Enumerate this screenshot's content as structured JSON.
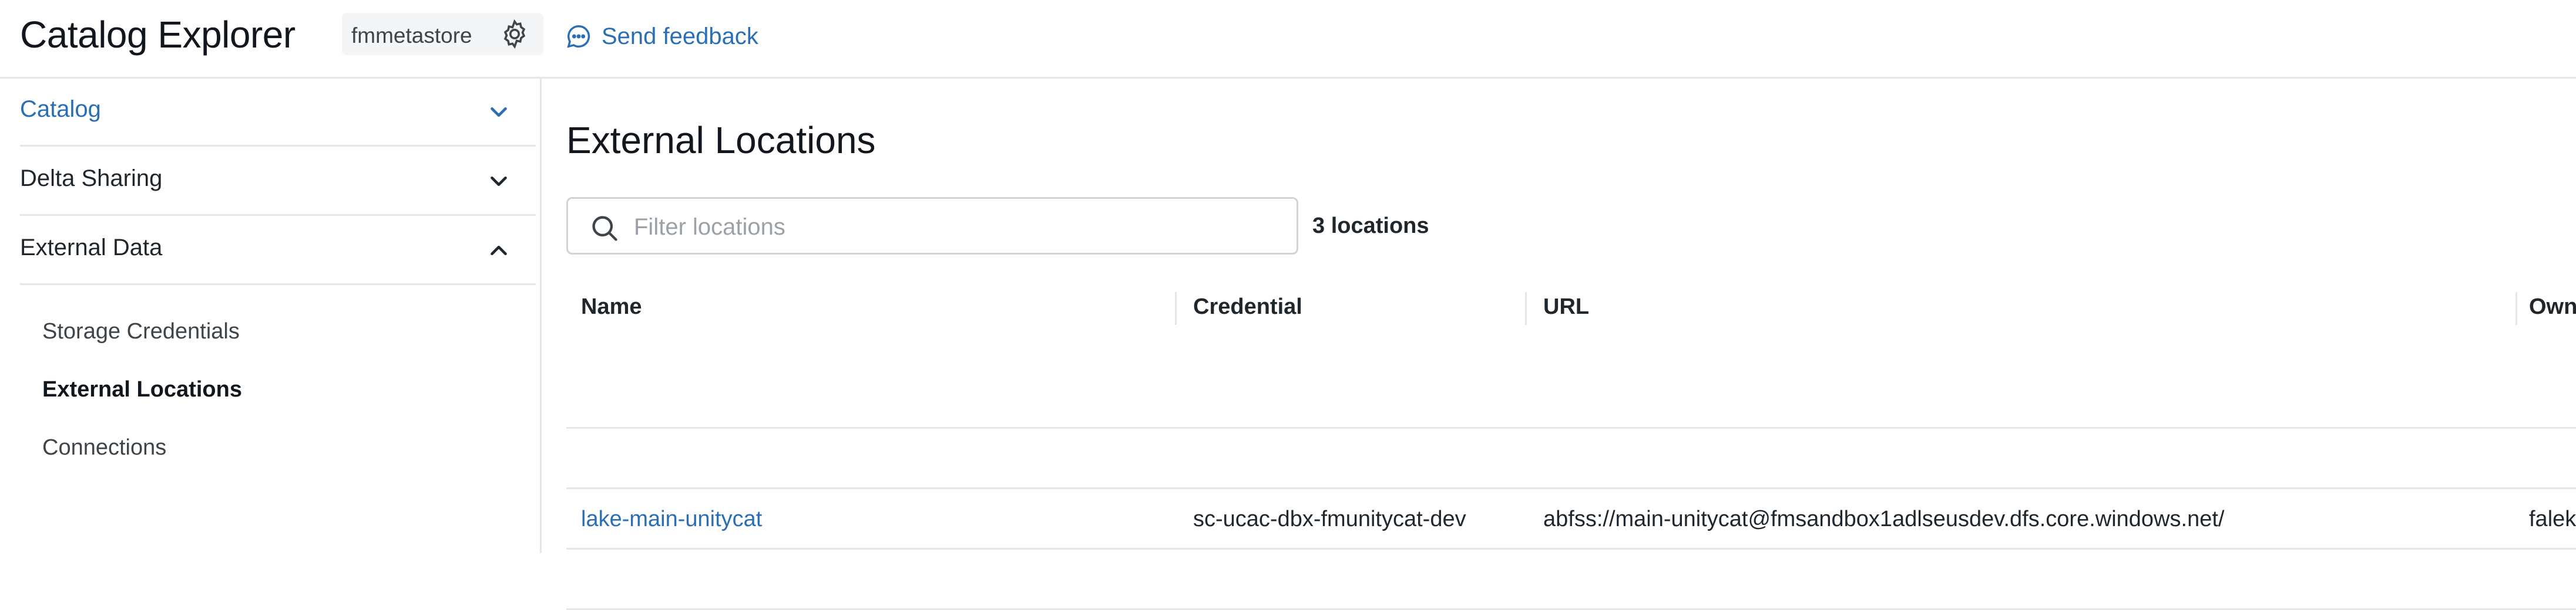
{
  "header": {
    "app_title": "Catalog Explorer",
    "metastore": "fmmetastore",
    "settings_icon": "gear-icon",
    "feedback_label": "Send feedback",
    "feedback_icon": "chat-bubble-icon"
  },
  "sidebar": {
    "sections": [
      {
        "label": "Catalog",
        "expanded": false,
        "color": "#2a6fb4"
      },
      {
        "label": "Delta Sharing",
        "expanded": false
      },
      {
        "label": "External Data",
        "expanded": true
      }
    ],
    "sub_items": [
      {
        "label": "Storage Credentials",
        "active": false
      },
      {
        "label": "External Locations",
        "active": true
      },
      {
        "label": "Connections",
        "active": false
      }
    ]
  },
  "main": {
    "title": "External Locations",
    "filter_placeholder": "Filter locations",
    "filter_value": "",
    "count_label": "3 locations",
    "columns": [
      "Name",
      "Credential",
      "URL",
      "Owner"
    ],
    "rows": [
      {
        "name": "lake-main-unitycat",
        "credential": "sc-ucac-dbx-fmunitycat-dev",
        "url": "abfss://main-unitycat@fmsandbox1adlseusdev.dfs.core.windows.net/",
        "owner": "falek@"
      }
    ]
  },
  "colors": {
    "accent": "#2a6fb4",
    "border": "#e4e6e9",
    "text": "#1f272d"
  }
}
